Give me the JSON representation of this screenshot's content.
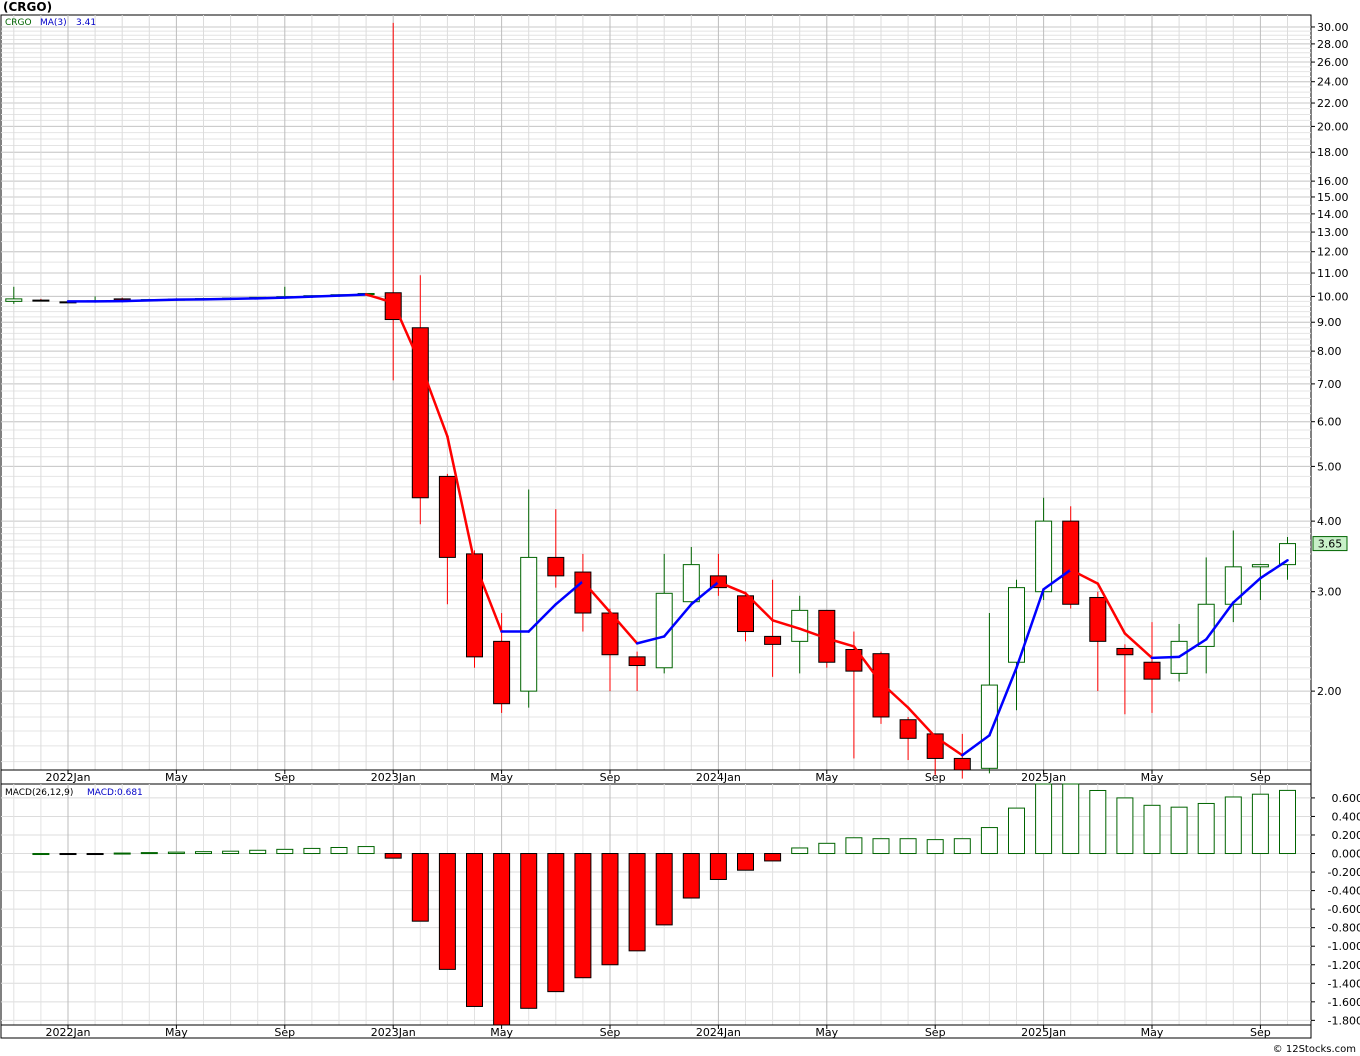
{
  "title": "(CRGO)",
  "footer": "© 12Stocks.com",
  "colors": {
    "up": "#006400",
    "down": "#ff0000",
    "ma_down": "#ff0000",
    "ma_up": "#0000ff",
    "grid": "#c8c8c8",
    "last_price_bg": "#c8f0c8"
  },
  "chart_data": [
    {
      "type": "candlestick",
      "title": "",
      "scale": "log",
      "ylim": [
        1.45,
        31.5
      ],
      "legend": {
        "ticker": "CRGO",
        "ma_label": "MA(3)",
        "ma_value": "3.41"
      },
      "last_price": "3.65",
      "ytick_labels": [
        "30.00",
        "28.00",
        "26.00",
        "24.00",
        "22.00",
        "20.00",
        "18.00",
        "16.00",
        "15.00",
        "14.00",
        "13.00",
        "12.00",
        "11.00",
        "10.00",
        "9.00",
        "8.00",
        "7.00",
        "6.00",
        "5.00",
        "4.00",
        "3.00",
        "2.00"
      ],
      "ytick_values": [
        30,
        28,
        26,
        24,
        22,
        20,
        18,
        16,
        15,
        14,
        13,
        12,
        11,
        10,
        9,
        8,
        7,
        6,
        5,
        4,
        3,
        2
      ],
      "x_labels": [
        {
          "label": "2022Jan",
          "month": 0
        },
        {
          "label": "May",
          "month": 4
        },
        {
          "label": "Sep",
          "month": 8
        },
        {
          "label": "2023Jan",
          "month": 12
        },
        {
          "label": "May",
          "month": 16
        },
        {
          "label": "Sep",
          "month": 20
        },
        {
          "label": "2024Jan",
          "month": 24
        },
        {
          "label": "May",
          "month": 28
        },
        {
          "label": "Sep",
          "month": 32
        },
        {
          "label": "2025Jan",
          "month": 36
        },
        {
          "label": "May",
          "month": 40
        },
        {
          "label": "Sep",
          "month": 44
        }
      ],
      "candles": [
        {
          "m": -2,
          "o": 9.8,
          "h": 10.4,
          "l": 9.7,
          "c": 9.9
        },
        {
          "m": -1,
          "o": 9.85,
          "h": 9.9,
          "l": 9.8,
          "c": 9.82
        },
        {
          "m": 0,
          "o": 9.78,
          "h": 9.82,
          "l": 9.75,
          "c": 9.76
        },
        {
          "m": 1,
          "o": 9.8,
          "h": 10.0,
          "l": 9.75,
          "c": 9.82
        },
        {
          "m": 2,
          "o": 9.9,
          "h": 9.95,
          "l": 9.85,
          "c": 9.85
        },
        {
          "m": 3,
          "o": 9.86,
          "h": 9.9,
          "l": 9.84,
          "c": 9.87
        },
        {
          "m": 4,
          "o": 9.88,
          "h": 9.92,
          "l": 9.86,
          "c": 9.89
        },
        {
          "m": 5,
          "o": 9.9,
          "h": 9.94,
          "l": 9.88,
          "c": 9.91
        },
        {
          "m": 6,
          "o": 9.92,
          "h": 9.96,
          "l": 9.9,
          "c": 9.93
        },
        {
          "m": 7,
          "o": 9.94,
          "h": 9.98,
          "l": 9.92,
          "c": 9.96
        },
        {
          "m": 8,
          "o": 9.97,
          "h": 10.4,
          "l": 9.95,
          "c": 9.99
        },
        {
          "m": 9,
          "o": 10.0,
          "h": 10.05,
          "l": 9.98,
          "c": 10.03
        },
        {
          "m": 10,
          "o": 10.04,
          "h": 10.09,
          "l": 10.02,
          "c": 10.07
        },
        {
          "m": 11,
          "o": 10.08,
          "h": 10.13,
          "l": 10.05,
          "c": 10.12
        },
        {
          "m": 12,
          "o": 10.15,
          "h": 30.5,
          "l": 7.1,
          "c": 9.1
        },
        {
          "m": 13,
          "o": 8.8,
          "h": 10.9,
          "l": 3.95,
          "c": 4.4
        },
        {
          "m": 14,
          "o": 4.8,
          "h": 4.85,
          "l": 2.85,
          "c": 3.45
        },
        {
          "m": 15,
          "o": 3.5,
          "h": 3.55,
          "l": 2.2,
          "c": 2.3
        },
        {
          "m": 16,
          "o": 2.45,
          "h": 2.75,
          "l": 1.83,
          "c": 1.9
        },
        {
          "m": 17,
          "o": 2.0,
          "h": 4.55,
          "l": 1.87,
          "c": 3.45
        },
        {
          "m": 18,
          "o": 3.45,
          "h": 4.2,
          "l": 3.05,
          "c": 3.2
        },
        {
          "m": 19,
          "o": 3.25,
          "h": 3.5,
          "l": 2.55,
          "c": 2.75
        },
        {
          "m": 20,
          "o": 2.75,
          "h": 2.8,
          "l": 2.0,
          "c": 2.32
        },
        {
          "m": 21,
          "o": 2.3,
          "h": 2.35,
          "l": 2.0,
          "c": 2.22
        },
        {
          "m": 22,
          "o": 2.2,
          "h": 3.5,
          "l": 2.15,
          "c": 2.98
        },
        {
          "m": 23,
          "o": 2.88,
          "h": 3.6,
          "l": 2.85,
          "c": 3.35
        },
        {
          "m": 24,
          "o": 3.2,
          "h": 3.5,
          "l": 2.95,
          "c": 3.05
        },
        {
          "m": 25,
          "o": 2.95,
          "h": 3.0,
          "l": 2.45,
          "c": 2.55
        },
        {
          "m": 26,
          "o": 2.5,
          "h": 3.15,
          "l": 2.12,
          "c": 2.42
        },
        {
          "m": 27,
          "o": 2.45,
          "h": 2.95,
          "l": 2.15,
          "c": 2.78
        },
        {
          "m": 28,
          "o": 2.78,
          "h": 2.78,
          "l": 2.2,
          "c": 2.25
        },
        {
          "m": 29,
          "o": 2.37,
          "h": 2.55,
          "l": 1.52,
          "c": 2.17
        },
        {
          "m": 30,
          "o": 2.33,
          "h": 2.35,
          "l": 1.75,
          "c": 1.8
        },
        {
          "m": 31,
          "o": 1.78,
          "h": 1.8,
          "l": 1.51,
          "c": 1.65
        },
        {
          "m": 32,
          "o": 1.68,
          "h": 1.68,
          "l": 1.42,
          "c": 1.52
        },
        {
          "m": 33,
          "o": 1.52,
          "h": 1.68,
          "l": 1.4,
          "c": 1.45
        },
        {
          "m": 34,
          "o": 1.46,
          "h": 2.75,
          "l": 1.43,
          "c": 2.05
        },
        {
          "m": 35,
          "o": 2.25,
          "h": 3.15,
          "l": 1.85,
          "c": 3.05
        },
        {
          "m": 36,
          "o": 3.0,
          "h": 4.4,
          "l": 2.9,
          "c": 4.0
        },
        {
          "m": 37,
          "o": 4.0,
          "h": 4.25,
          "l": 2.8,
          "c": 2.85
        },
        {
          "m": 38,
          "o": 2.93,
          "h": 3.0,
          "l": 2.0,
          "c": 2.45
        },
        {
          "m": 39,
          "o": 2.38,
          "h": 2.42,
          "l": 1.82,
          "c": 2.32
        },
        {
          "m": 40,
          "o": 2.25,
          "h": 2.65,
          "l": 1.83,
          "c": 2.1
        },
        {
          "m": 41,
          "o": 2.15,
          "h": 2.63,
          "l": 2.08,
          "c": 2.45
        },
        {
          "m": 42,
          "o": 2.4,
          "h": 3.45,
          "l": 2.15,
          "c": 2.85
        },
        {
          "m": 43,
          "o": 2.85,
          "h": 3.85,
          "l": 2.65,
          "c": 3.32
        },
        {
          "m": 44,
          "o": 3.32,
          "h": 3.36,
          "l": 2.9,
          "c": 3.35
        },
        {
          "m": 45,
          "o": 3.35,
          "h": 3.75,
          "l": 3.15,
          "c": 3.65
        }
      ],
      "ma": [
        {
          "m": 0,
          "v": 9.8
        },
        {
          "m": 1,
          "v": 9.8
        },
        {
          "m": 2,
          "v": 9.81
        },
        {
          "m": 3,
          "v": 9.84
        },
        {
          "m": 4,
          "v": 9.87
        },
        {
          "m": 5,
          "v": 9.88
        },
        {
          "m": 6,
          "v": 9.9
        },
        {
          "m": 7,
          "v": 9.92
        },
        {
          "m": 8,
          "v": 9.95
        },
        {
          "m": 9,
          "v": 9.99
        },
        {
          "m": 10,
          "v": 10.03
        },
        {
          "m": 11,
          "v": 10.08
        },
        {
          "m": 12,
          "v": 9.75
        },
        {
          "m": 13,
          "v": 7.6
        },
        {
          "m": 14,
          "v": 5.65
        },
        {
          "m": 15,
          "v": 3.38
        },
        {
          "m": 16,
          "v": 2.55
        },
        {
          "m": 17,
          "v": 2.55
        },
        {
          "m": 18,
          "v": 2.85
        },
        {
          "m": 19,
          "v": 3.13
        },
        {
          "m": 20,
          "v": 2.76
        },
        {
          "m": 21,
          "v": 2.43
        },
        {
          "m": 22,
          "v": 2.5
        },
        {
          "m": 23,
          "v": 2.85
        },
        {
          "m": 24,
          "v": 3.12
        },
        {
          "m": 25,
          "v": 2.98
        },
        {
          "m": 26,
          "v": 2.67
        },
        {
          "m": 27,
          "v": 2.58
        },
        {
          "m": 28,
          "v": 2.48
        },
        {
          "m": 29,
          "v": 2.4
        },
        {
          "m": 30,
          "v": 2.07
        },
        {
          "m": 31,
          "v": 1.87
        },
        {
          "m": 32,
          "v": 1.66
        },
        {
          "m": 33,
          "v": 1.54
        },
        {
          "m": 34,
          "v": 1.67
        },
        {
          "m": 35,
          "v": 2.2
        },
        {
          "m": 36,
          "v": 3.03
        },
        {
          "m": 37,
          "v": 3.28
        },
        {
          "m": 38,
          "v": 3.1
        },
        {
          "m": 39,
          "v": 2.53
        },
        {
          "m": 40,
          "v": 2.29
        },
        {
          "m": 41,
          "v": 2.3
        },
        {
          "m": 42,
          "v": 2.47
        },
        {
          "m": 43,
          "v": 2.87
        },
        {
          "m": 44,
          "v": 3.17
        },
        {
          "m": 45,
          "v": 3.41
        }
      ]
    },
    {
      "type": "bar",
      "title": "",
      "legend": {
        "label": "MACD(26,12,9)",
        "value_label": "MACD:0.681"
      },
      "ylim": [
        -1.85,
        0.75
      ],
      "ytick_labels": [
        "0.600",
        "0.400",
        "0.200",
        "0.000",
        "-0.200",
        "-0.400",
        "-0.600",
        "-0.800",
        "-1.000",
        "-1.200",
        "-1.400",
        "-1.600",
        "-1.800"
      ],
      "ytick_values": [
        0.6,
        0.4,
        0.2,
        0.0,
        -0.2,
        -0.4,
        -0.6,
        -0.8,
        -1.0,
        -1.2,
        -1.4,
        -1.6,
        -1.8
      ],
      "x_labels": [
        {
          "label": "2022Jan",
          "month": 0
        },
        {
          "label": "May",
          "month": 4
        },
        {
          "label": "Sep",
          "month": 8
        },
        {
          "label": "2023Jan",
          "month": 12
        },
        {
          "label": "May",
          "month": 16
        },
        {
          "label": "Sep",
          "month": 20
        },
        {
          "label": "2024Jan",
          "month": 24
        },
        {
          "label": "May",
          "month": 28
        },
        {
          "label": "Sep",
          "month": 32
        },
        {
          "label": "2025Jan",
          "month": 36
        },
        {
          "label": "May",
          "month": 40
        },
        {
          "label": "Sep",
          "month": 44
        }
      ],
      "values": [
        {
          "m": -1,
          "v": 0.0
        },
        {
          "m": 0,
          "v": -0.01
        },
        {
          "m": 1,
          "v": -0.01
        },
        {
          "m": 2,
          "v": 0.005
        },
        {
          "m": 3,
          "v": 0.01
        },
        {
          "m": 4,
          "v": 0.015
        },
        {
          "m": 5,
          "v": 0.02
        },
        {
          "m": 6,
          "v": 0.025
        },
        {
          "m": 7,
          "v": 0.035
        },
        {
          "m": 8,
          "v": 0.045
        },
        {
          "m": 9,
          "v": 0.055
        },
        {
          "m": 10,
          "v": 0.065
        },
        {
          "m": 11,
          "v": 0.075
        },
        {
          "m": 12,
          "v": -0.05
        },
        {
          "m": 13,
          "v": -0.73
        },
        {
          "m": 14,
          "v": -1.25
        },
        {
          "m": 15,
          "v": -1.65
        },
        {
          "m": 16,
          "v": -1.85
        },
        {
          "m": 17,
          "v": -1.67
        },
        {
          "m": 18,
          "v": -1.49
        },
        {
          "m": 19,
          "v": -1.34
        },
        {
          "m": 20,
          "v": -1.2
        },
        {
          "m": 21,
          "v": -1.05
        },
        {
          "m": 22,
          "v": -0.77
        },
        {
          "m": 23,
          "v": -0.48
        },
        {
          "m": 24,
          "v": -0.28
        },
        {
          "m": 25,
          "v": -0.18
        },
        {
          "m": 26,
          "v": -0.08
        },
        {
          "m": 27,
          "v": 0.06
        },
        {
          "m": 28,
          "v": 0.11
        },
        {
          "m": 29,
          "v": 0.17
        },
        {
          "m": 30,
          "v": 0.16
        },
        {
          "m": 31,
          "v": 0.16
        },
        {
          "m": 32,
          "v": 0.15
        },
        {
          "m": 33,
          "v": 0.16
        },
        {
          "m": 34,
          "v": 0.28
        },
        {
          "m": 35,
          "v": 0.49
        },
        {
          "m": 36,
          "v": 0.75
        },
        {
          "m": 37,
          "v": 0.75
        },
        {
          "m": 38,
          "v": 0.68
        },
        {
          "m": 39,
          "v": 0.6
        },
        {
          "m": 40,
          "v": 0.52
        },
        {
          "m": 41,
          "v": 0.5
        },
        {
          "m": 42,
          "v": 0.54
        },
        {
          "m": 43,
          "v": 0.61
        },
        {
          "m": 44,
          "v": 0.64
        },
        {
          "m": 45,
          "v": 0.681
        }
      ]
    }
  ]
}
